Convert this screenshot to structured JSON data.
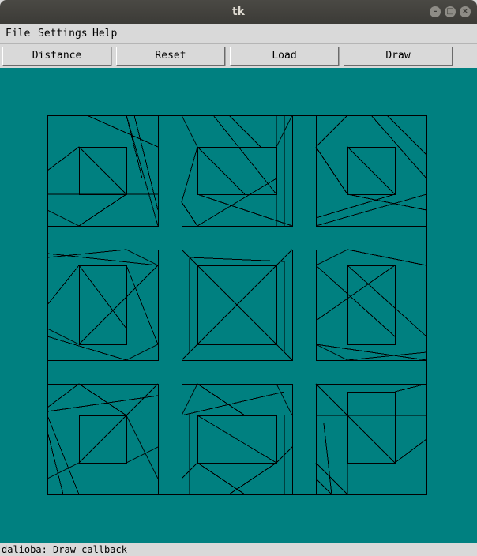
{
  "window": {
    "title": "tk",
    "minimize": "–",
    "maximize": "□",
    "close": "×"
  },
  "menubar": {
    "items": [
      {
        "label": "File"
      },
      {
        "label": "Settings"
      },
      {
        "label": "Help"
      }
    ]
  },
  "toolbar": {
    "buttons": [
      {
        "label": "Distance"
      },
      {
        "label": "Reset"
      },
      {
        "label": "Load"
      },
      {
        "label": "Draw"
      }
    ]
  },
  "canvas": {
    "background": "#008080",
    "line_color": "#000000"
  },
  "status": {
    "text": "dalioba: Draw callback"
  }
}
